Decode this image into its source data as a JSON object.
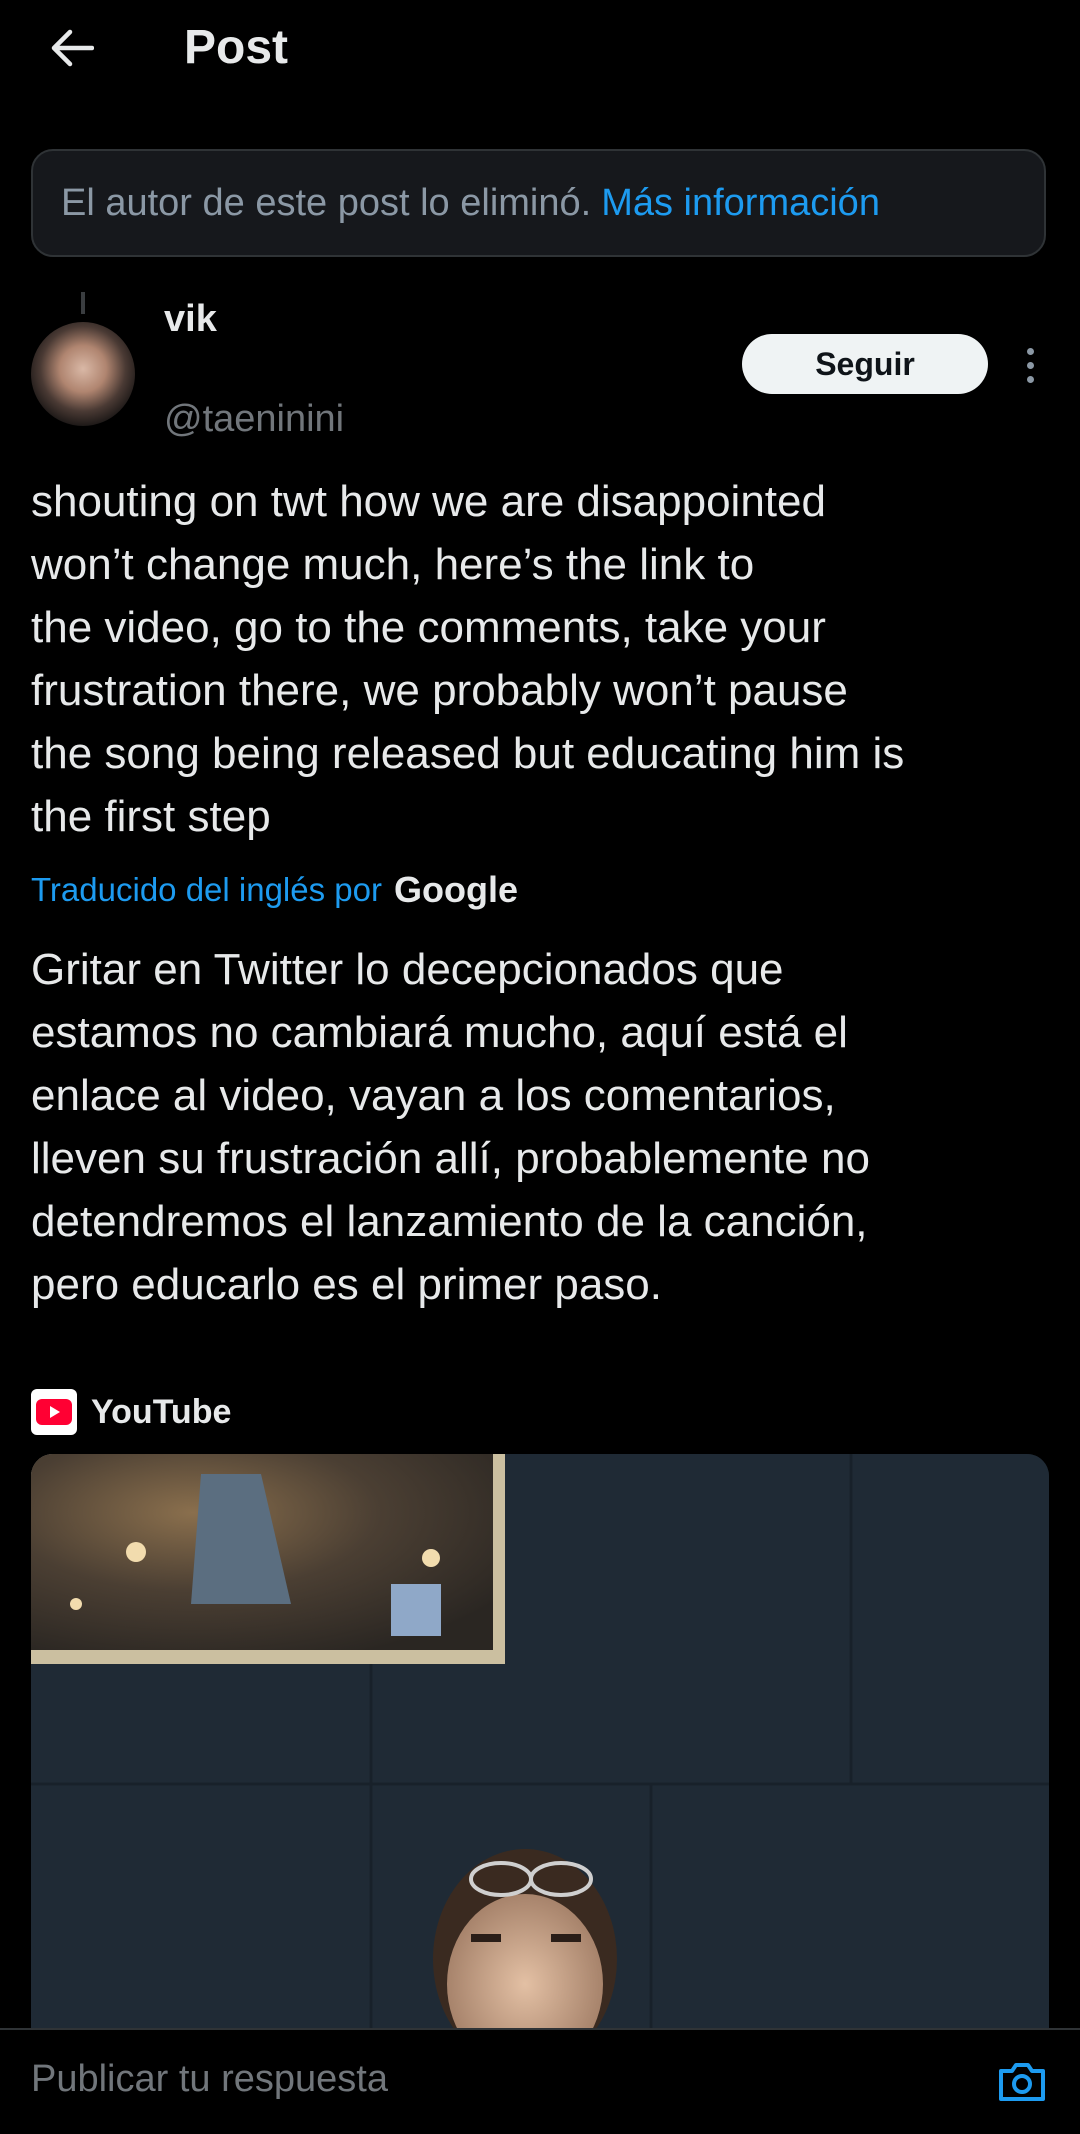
{
  "header": {
    "title": "Post"
  },
  "notice": {
    "text": "El autor de este post lo eliminó.",
    "link": "Más información"
  },
  "author": {
    "name": "vik",
    "handle": "@taeninini",
    "follow_label": "Seguir"
  },
  "post": {
    "text": "shouting on twt how we are disappointed\nwon’t change much, here’s the link to\nthe video, go to the comments, take your\nfrustration there, we probably won’t pause\nthe song being released but educating him is\nthe first step"
  },
  "translation": {
    "label": "Traducido del inglés por",
    "provider": "Google",
    "text": "Gritar en Twitter lo decepcionados que\nestamos no cambiará mucho, aquí está el\nenlace al video, vayan a los comentarios,\nlleven su frustración allí, probablemente no\ndetendremos el lanzamiento de la canción,\npero educarlo es el primer paso."
  },
  "link_card": {
    "source": "YouTube"
  },
  "reply": {
    "placeholder": "Publicar tu respuesta"
  },
  "colors": {
    "background": "#000000",
    "text": "#e7e9ea",
    "secondary": "#71767b",
    "accent": "#1d9bf0",
    "youtube_red": "#ff0033"
  },
  "icons": [
    "back-arrow-icon",
    "more-vertical-icon",
    "youtube-icon",
    "camera-icon"
  ]
}
